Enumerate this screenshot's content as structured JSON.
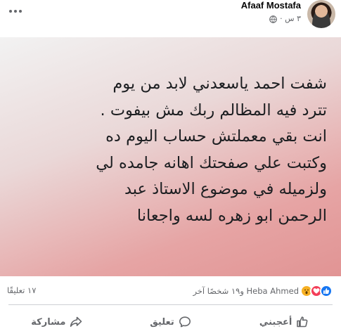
{
  "post": {
    "author_name": "Afaaf Mostafa",
    "time_ago": "٣ س ·",
    "privacy_icon": "globe-icon"
  },
  "text_card": {
    "lines": [
      "شفت احمد ياسعدني لابد من يوم",
      "تترد فيه المظالم ربك مش بيفوت .",
      "انت بقي معملتش حساب اليوم ده",
      "وكتبت علي صفحتك اهانه جامده لي",
      "ولزميله في موضوع الاستاذ عبد",
      "الرحمن ابو زهره لسه واجعانا"
    ],
    "gradient": [
      "#f2f2f2",
      "#ead8d8",
      "#e6a4a4",
      "#e19494"
    ]
  },
  "stats": {
    "reactions_text": "Heba Ahmed و١٩ شخصًا آخر",
    "comments_text": "١٧ تعليقًا",
    "reaction_icons": [
      "like-icon",
      "love-icon",
      "wow-icon"
    ]
  },
  "actions": {
    "like": "أعجبني",
    "comment": "تعليق",
    "share": "مشاركة"
  },
  "colors": {
    "like_blue": "#1877f2",
    "love_red": "#f33e58",
    "wow_yellow": "#f7b125",
    "secondary_text": "#65676b"
  }
}
